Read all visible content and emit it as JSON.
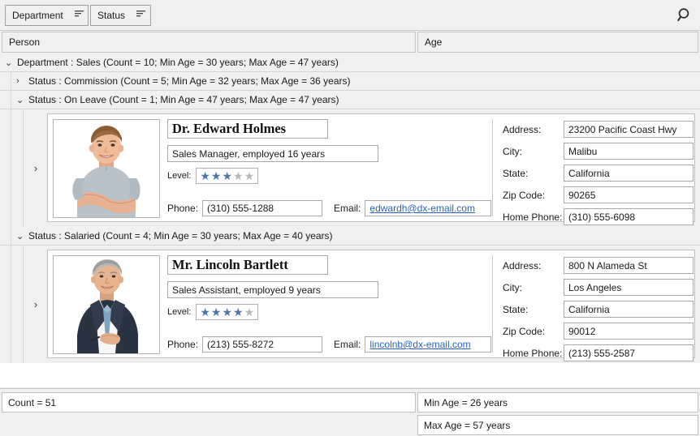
{
  "groupbar": {
    "chips": [
      {
        "label": "Department",
        "icon": "sort-ascending-icon"
      },
      {
        "label": "Status",
        "icon": "sort-ascending-icon"
      }
    ],
    "search_icon": "search-icon"
  },
  "columns": [
    {
      "label": "Person"
    },
    {
      "label": "Age"
    }
  ],
  "groups": [
    {
      "level": 1,
      "expanded": true,
      "arrow": "⌄",
      "text": "Department : Sales (Count = 10; Min Age = 30 years; Max Age = 47 years)"
    },
    {
      "level": 2,
      "expanded": false,
      "arrow": "›",
      "text": "Status : Commission (Count = 5; Min Age = 32 years; Max Age = 36 years)"
    },
    {
      "level": 2,
      "expanded": true,
      "arrow": "⌄",
      "text": "Status : On Leave (Count = 1; Min Age = 47 years; Max Age = 47 years)"
    },
    {
      "level": 2,
      "expanded": true,
      "arrow": "⌄",
      "text": "Status : Salaried (Count = 4; Min Age = 30 years; Max Age = 40 years)"
    }
  ],
  "cards": [
    {
      "expander_arrow": "›",
      "photo": "portrait-young-man-gray-tshirt",
      "name": "Dr. Edward Holmes",
      "position": "Sales Manager, employed 16 years",
      "level_label": "Level:",
      "level_filled": 3,
      "level_total": 5,
      "phone_label": "Phone:",
      "phone": "(310) 555-1288",
      "email_label": "Email:",
      "email": "edwardh@dx-email.com",
      "address_label": "Address:",
      "address": "23200 Pacific Coast Hwy",
      "city_label": "City:",
      "city": "Malibu",
      "state_label": "State:",
      "state": "California",
      "zip_label": "Zip Code:",
      "zip": "90265",
      "home_phone_label": "Home Phone:",
      "home_phone": "(310) 555-6098"
    },
    {
      "expander_arrow": "›",
      "photo": "portrait-older-man-dark-suit",
      "name": "Mr. Lincoln Bartlett",
      "position": "Sales Assistant, employed 9 years",
      "level_label": "Level:",
      "level_filled": 4,
      "level_total": 5,
      "phone_label": "Phone:",
      "phone": "(213) 555-8272",
      "email_label": "Email:",
      "email": "lincolnb@dx-email.com",
      "address_label": "Address:",
      "address": "800 N Alameda St",
      "city_label": "City:",
      "city": "Los Angeles",
      "state_label": "State:",
      "state": "California",
      "zip_label": "Zip Code:",
      "zip": "90012",
      "home_phone_label": "Home Phone:",
      "home_phone": "(213) 555-2587"
    }
  ],
  "summary": {
    "count": "Count = 51",
    "min_age": "Min Age =  26 years",
    "max_age": "Max Age = 57 years"
  },
  "colors": {
    "star_on": "#4f74a8",
    "star_off": "#b8b8b8",
    "link": "#2a62b8",
    "panel": "#f0f0f0",
    "card": "#ffffff",
    "border": "#bfbfbf"
  }
}
